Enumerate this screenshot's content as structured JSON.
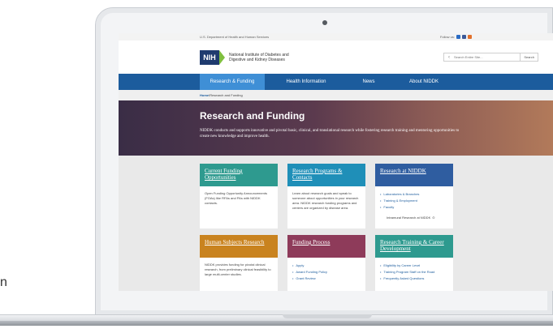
{
  "gov_bar": {
    "agency": "U.S. Department of Health and Human Services",
    "follow_label": "Follow us:",
    "social_colors": [
      "#2b6cc4",
      "#3b5998",
      "#e2702a"
    ]
  },
  "header": {
    "logo_text": "NIH",
    "org_name": "National Institute of Diabetes and Digestive and Kidney Diseases",
    "search_placeholder": "Search Entire Site...",
    "search_button": "Search"
  },
  "nav": {
    "items": [
      {
        "label": "Research & Funding"
      },
      {
        "label": "Health Information"
      },
      {
        "label": "News"
      },
      {
        "label": "About NIDDK"
      }
    ]
  },
  "breadcrumb": {
    "home": "Home",
    "separator": " \\ ",
    "current": "Research and Funding"
  },
  "hero": {
    "title": "Research and Funding",
    "description": "NIDDK conducts and supports innovative and pivotal basic, clinical, and translational research while fostering research training and mentoring opportunities to create new knowledge and improve health."
  },
  "cards": [
    {
      "title": "Current Funding Opportunities",
      "color": "#2e9a8f",
      "body": "Open Funding Opportunity Announcements (FOAs) like RFAs and PAs with NIDDK contacts."
    },
    {
      "title": "Research Programs & Contacts",
      "color": "#1f8fb8",
      "body": "Learn about research goals and speak to someone about opportunities in your research area. NIDDK research funding programs and centers are organized by disease area."
    },
    {
      "title": "Research at NIDDK",
      "color": "#2f5da0",
      "items": [
        "Laboratories & Branches",
        "Training & Employment",
        "Faculty"
      ],
      "note": "Intramural Research at NIDDK"
    },
    {
      "title": "Human Subjects Research",
      "color": "#c9831f",
      "body": "NIDDK provides funding for pivotal clinical research, from preliminary clinical feasibility to large multi-center studies."
    },
    {
      "title": "Funding Process",
      "color": "#8e3b5a",
      "items": [
        "Apply",
        "Award Funding Policy",
        "Grant Review"
      ]
    },
    {
      "title": "Research Training & Career Development",
      "color": "#2e9a8f",
      "items": [
        "Eligibility by Career Level",
        "Training Program Staff on the Road",
        "Frequently Asked Questions"
      ]
    }
  ],
  "side_glyph": "n"
}
